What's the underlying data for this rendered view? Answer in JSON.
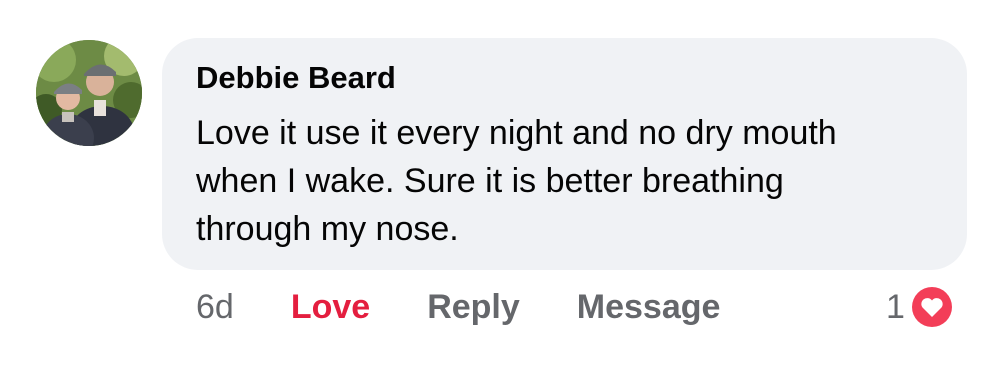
{
  "comment": {
    "author": "Debbie Beard",
    "text": "Love it use it every night and no dry mouth when I wake. Sure it is better breathing through my nose.",
    "time": "6d",
    "actions": {
      "love": "Love",
      "reply": "Reply",
      "message": "Message"
    },
    "reaction_count": "1",
    "reaction_icon": "heart-icon",
    "colors": {
      "bubble": "#f0f2f5",
      "love_active": "#e41e3f",
      "muted": "#65676b"
    }
  }
}
